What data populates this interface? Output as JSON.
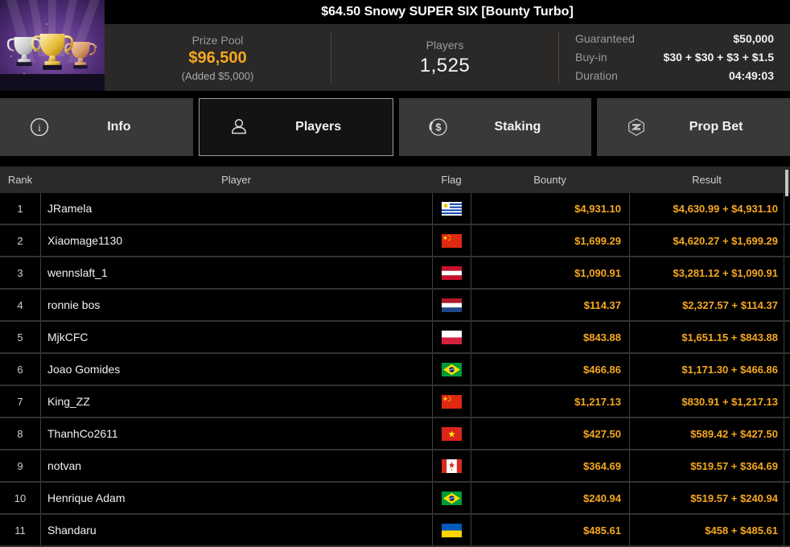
{
  "title": "$64.50 Snowy SUPER SIX [Bounty Turbo]",
  "header": {
    "prize_pool": {
      "label": "Prize Pool",
      "value": "$96,500",
      "added": "(Added $5,000)"
    },
    "players": {
      "label": "Players",
      "value": "1,525"
    },
    "details": [
      {
        "label": "Guaranteed",
        "value": "$50,000"
      },
      {
        "label": "Buy-in",
        "value": "$30 + $30 + $3 + $1.5"
      },
      {
        "label": "Duration",
        "value": "04:49:03"
      }
    ]
  },
  "tabs": [
    {
      "label": "Info",
      "icon": "info-icon",
      "active": false
    },
    {
      "label": "Players",
      "icon": "players-icon",
      "active": true
    },
    {
      "label": "Staking",
      "icon": "staking-icon",
      "active": false
    },
    {
      "label": "Prop Bet",
      "icon": "prop-bet-icon",
      "active": false
    }
  ],
  "table": {
    "columns": [
      "Rank",
      "Player",
      "Flag",
      "Bounty",
      "Result"
    ],
    "rows": [
      {
        "rank": "1",
        "player": "JRamela",
        "flag": "uruguay",
        "bounty": "$4,931.10",
        "result": "$4,630.99 + $4,931.10"
      },
      {
        "rank": "2",
        "player": "Xiaomage1130",
        "flag": "china",
        "bounty": "$1,699.29",
        "result": "$4,620.27 + $1,699.29"
      },
      {
        "rank": "3",
        "player": "wennslaft_1",
        "flag": "austria",
        "bounty": "$1,090.91",
        "result": "$3,281.12 + $1,090.91"
      },
      {
        "rank": "4",
        "player": "ronnie bos",
        "flag": "netherlands",
        "bounty": "$114.37",
        "result": "$2,327.57 + $114.37"
      },
      {
        "rank": "5",
        "player": "MjkCFC",
        "flag": "poland",
        "bounty": "$843.88",
        "result": "$1,651.15 + $843.88"
      },
      {
        "rank": "6",
        "player": "Joao Gomides",
        "flag": "brazil",
        "bounty": "$466.86",
        "result": "$1,171.30 + $466.86"
      },
      {
        "rank": "7",
        "player": "King_ZZ",
        "flag": "china",
        "bounty": "$1,217.13",
        "result": "$830.91 + $1,217.13"
      },
      {
        "rank": "8",
        "player": "ThanhCo2611",
        "flag": "vietnam",
        "bounty": "$427.50",
        "result": "$589.42 + $427.50"
      },
      {
        "rank": "9",
        "player": "notvan",
        "flag": "canada",
        "bounty": "$364.69",
        "result": "$519.57 + $364.69"
      },
      {
        "rank": "10",
        "player": "Henrique Adam",
        "flag": "brazil",
        "bounty": "$240.94",
        "result": "$519.57 + $240.94"
      },
      {
        "rank": "11",
        "player": "Shandaru",
        "flag": "ukraine",
        "bounty": "$485.61",
        "result": "$458 + $485.61"
      }
    ]
  },
  "colors": {
    "accent_gold": "#f6a81f",
    "panel_bg": "#2b2927",
    "tab_bg": "#3b3938",
    "tab_active_bg": "#151311",
    "tab_active_border": "#9b9b9b",
    "table_header_bg": "#2a2a28",
    "row_bg": "#000000",
    "divider": "#333231"
  }
}
